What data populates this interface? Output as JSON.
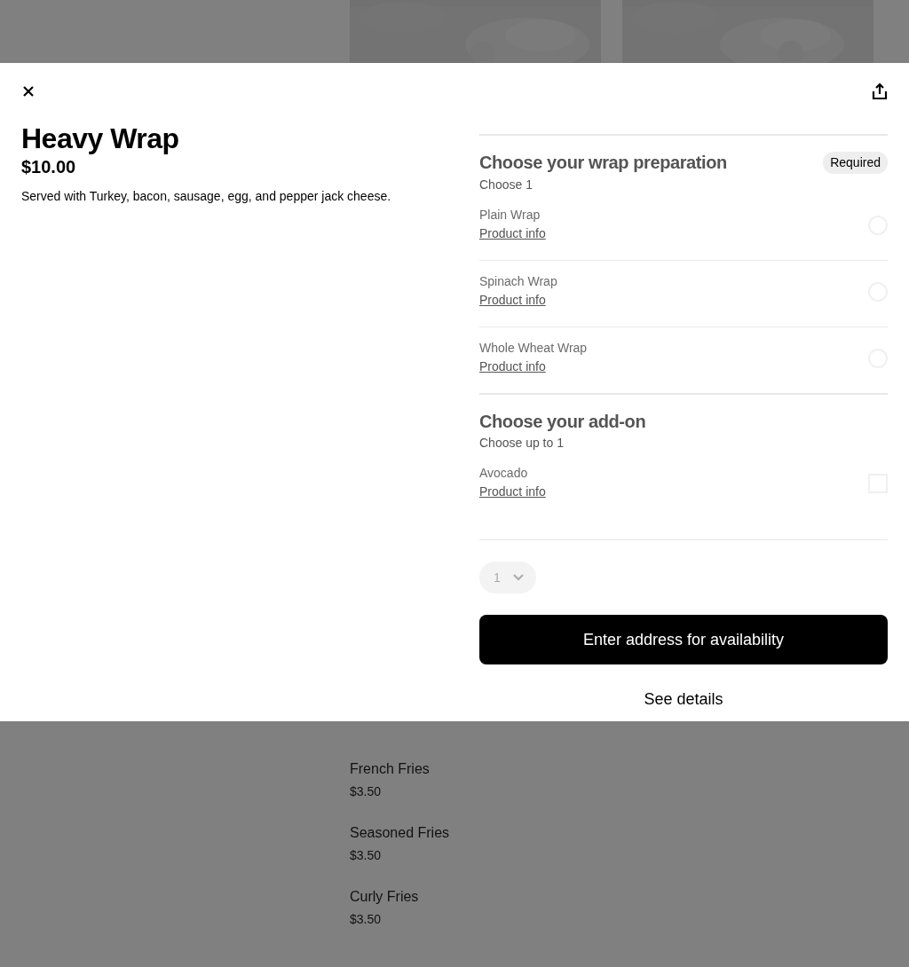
{
  "background": {
    "menu_items": [
      {
        "name": "French Fries",
        "price": "$3.50"
      },
      {
        "name": "Seasoned Fries",
        "price": "$3.50"
      },
      {
        "name": "Curly Fries",
        "price": "$3.50"
      }
    ]
  },
  "modal": {
    "title": "Heavy Wrap",
    "price": "$10.00",
    "description": "Served with Turkey, bacon, sausage, egg, and pepper jack cheese.",
    "groups": [
      {
        "title": "Choose your wrap preparation",
        "subtitle": "Choose 1",
        "badge": "Required",
        "kind": "radio",
        "options": [
          {
            "name": "Plain Wrap",
            "link": "Product info",
            "selected": false
          },
          {
            "name": "Spinach Wrap",
            "link": "Product info",
            "selected": false
          },
          {
            "name": "Whole Wheat Wrap",
            "link": "Product info",
            "selected": false
          }
        ]
      },
      {
        "title": "Choose your add-on",
        "subtitle": "Choose up to 1",
        "kind": "checkbox",
        "options": [
          {
            "name": "Avocado",
            "link": "Product info",
            "selected": false
          }
        ]
      }
    ],
    "quantity": {
      "value": "1",
      "disabled": true
    },
    "primary_button": "Enter address for availability",
    "secondary_button": "See details"
  }
}
